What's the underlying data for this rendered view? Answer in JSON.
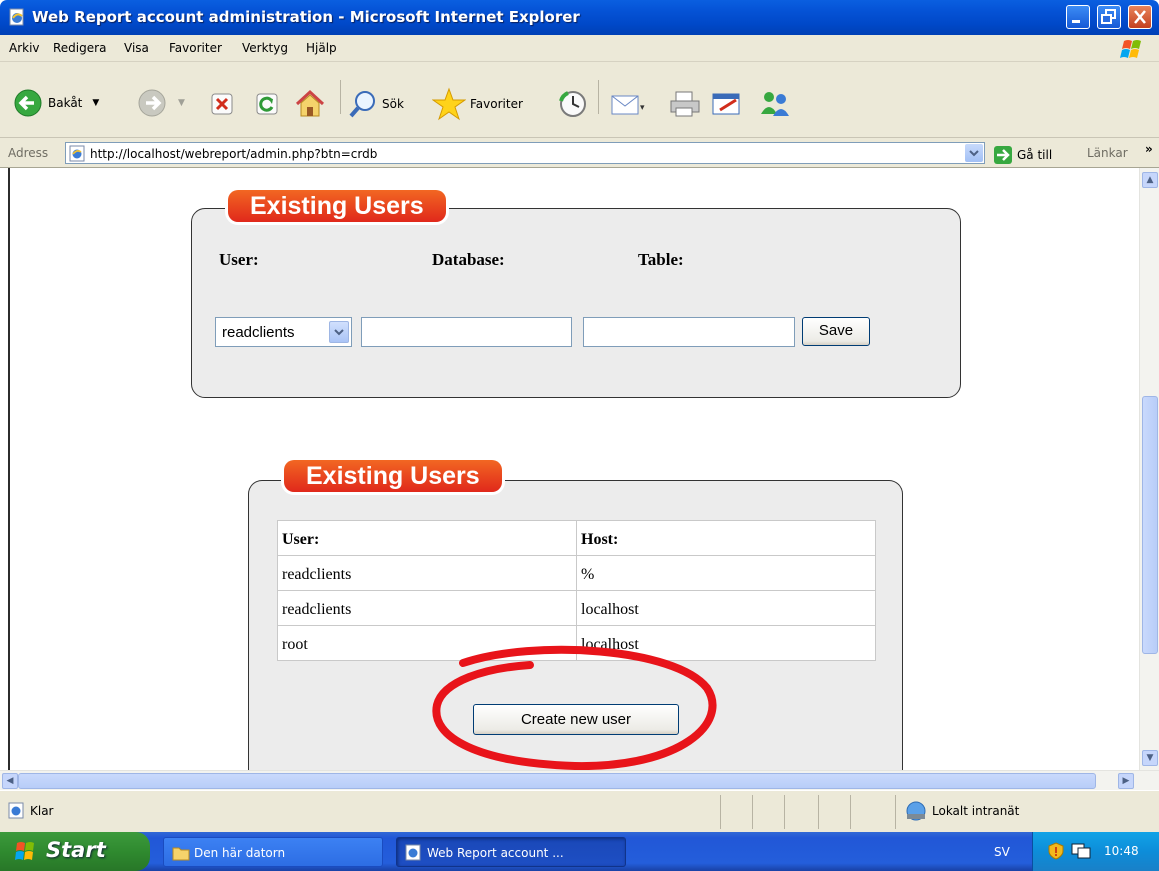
{
  "window": {
    "title": "Web Report account administration - Microsoft Internet Explorer"
  },
  "menu": [
    "Arkiv",
    "Redigera",
    "Visa",
    "Favoriter",
    "Verktyg",
    "Hjälp"
  ],
  "toolbar": {
    "back_label": "Bakåt",
    "search_label": "Sök",
    "favorites_label": "Favoriter"
  },
  "address": {
    "label": "Adress",
    "url": "http://localhost/webreport/admin.php?btn=crdb",
    "go_label": "Gå till",
    "links_label": "Länkar"
  },
  "panel1": {
    "legend": "Existing Users",
    "user_label": "User:",
    "database_label": "Database:",
    "table_label": "Table:",
    "user_select_value": "readclients",
    "database_value": "",
    "table_value": "",
    "save_label": "Save"
  },
  "panel2": {
    "legend": "Existing Users",
    "headers": [
      "User:",
      "Host:"
    ],
    "rows": [
      [
        "readclients",
        "%"
      ],
      [
        "readclients",
        "localhost"
      ],
      [
        "root",
        "localhost"
      ]
    ],
    "create_label": "Create new user"
  },
  "annotation": {
    "color": "#e8141a",
    "target": "create-new-user-button"
  },
  "statusbar": {
    "status": "Klar",
    "zone": "Lokalt intranät"
  },
  "taskbar": {
    "start_label": "Start",
    "tasks": [
      "Den här datorn",
      "Web Report account ..."
    ],
    "language": "SV",
    "time": "10:48"
  }
}
